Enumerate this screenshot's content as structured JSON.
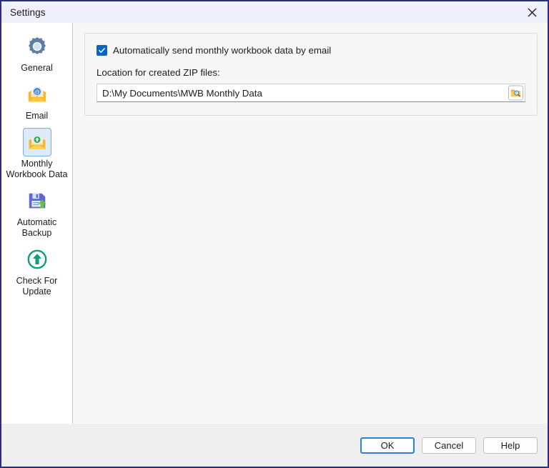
{
  "window": {
    "title": "Settings",
    "close_icon": "close-icon",
    "border_color": "#2b2b8f",
    "titlebar_color": "#eef0fb"
  },
  "sidebar": {
    "items": [
      {
        "label": "General",
        "icon": "gear-icon",
        "selected": false
      },
      {
        "label": "Email",
        "icon": "envelope-at-icon",
        "selected": false
      },
      {
        "label": "Monthly Workbook Data",
        "icon": "envelope-upload-icon",
        "selected": true
      },
      {
        "label": "Automatic Backup",
        "icon": "floppy-disk-upload-icon",
        "selected": false
      },
      {
        "label": "Check For Update",
        "icon": "circle-up-arrow-icon",
        "selected": false
      }
    ]
  },
  "main": {
    "checkbox": {
      "label": "Automatically send monthly workbook data by email",
      "checked": true,
      "accent_color": "#0a66c2"
    },
    "location": {
      "label": "Location for created ZIP files:",
      "value": "D:\\My Documents\\MWB Monthly Data",
      "placeholder": "",
      "browse_icon": "folder-search-icon"
    }
  },
  "footer": {
    "buttons": [
      {
        "label": "OK",
        "default": true
      },
      {
        "label": "Cancel",
        "default": false
      },
      {
        "label": "Help",
        "default": false
      }
    ]
  }
}
